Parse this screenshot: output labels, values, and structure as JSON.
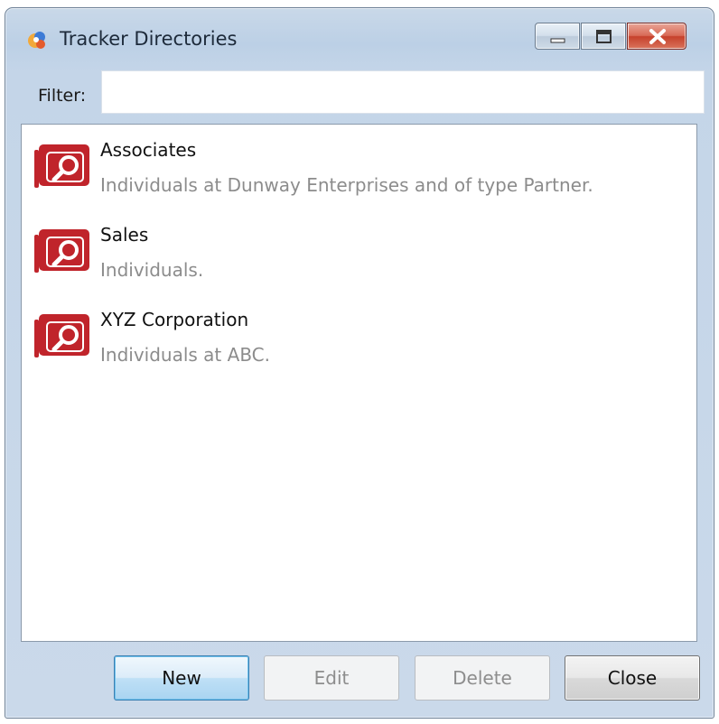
{
  "window": {
    "title": "Tracker Directories"
  },
  "filter": {
    "label": "Filter:",
    "value": "",
    "placeholder": ""
  },
  "directories": [
    {
      "name": "Associates",
      "description": "Individuals at Dunway Enterprises and of type Partner."
    },
    {
      "name": "Sales",
      "description": "Individuals."
    },
    {
      "name": "XYZ Corporation",
      "description": "Individuals at ABC."
    }
  ],
  "buttons": {
    "new": "New",
    "edit": "Edit",
    "delete": "Delete",
    "close": "Close"
  },
  "colors": {
    "directory_icon": "#c0242b",
    "title_bar": "#bcd0e6",
    "close_button": "#c6412c",
    "default_button_border": "#3c7fb1"
  },
  "icons": {
    "app": "tracker-app-icon",
    "directory": "directory-search-icon",
    "minimize": "minimize-icon",
    "maximize": "maximize-icon",
    "close": "close-icon"
  }
}
